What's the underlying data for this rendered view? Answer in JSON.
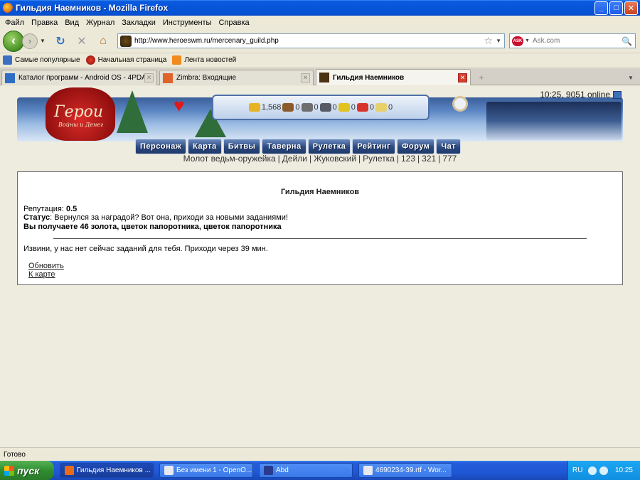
{
  "window": {
    "title": "Гильдия Наемников - Mozilla Firefox",
    "minimize": "_",
    "maximize": "□",
    "close": "✕"
  },
  "menu": [
    "Файл",
    "Правка",
    "Вид",
    "Журнал",
    "Закладки",
    "Инструменты",
    "Справка"
  ],
  "nav": {
    "url": "http://www.heroeswm.ru/mercenary_guild.php",
    "search_placeholder": "Ask.com",
    "search_engine_label": "ASK"
  },
  "bookmarks": [
    {
      "label": "Самые популярные",
      "icon": "popular-icon"
    },
    {
      "label": "Начальная страница",
      "icon": "start-page-icon"
    },
    {
      "label": "Лента новостей",
      "icon": "rss-icon"
    }
  ],
  "tabs": [
    {
      "label": "Каталог программ - Android OS - 4PDA",
      "active": false
    },
    {
      "label": "Zimbra: Входящие",
      "active": false
    },
    {
      "label": "Гильдия Наемников",
      "active": true
    }
  ],
  "game": {
    "logo_title": "Герои",
    "logo_subtitle": "Войны и Денег",
    "online": "10:25, 9051 online",
    "resources": [
      {
        "name": "gold",
        "value": "1,568"
      },
      {
        "name": "wood",
        "value": "0"
      },
      {
        "name": "ore",
        "value": "0"
      },
      {
        "name": "mercury",
        "value": "0"
      },
      {
        "name": "sulfur",
        "value": "0"
      },
      {
        "name": "crystal",
        "value": "0"
      },
      {
        "name": "gems",
        "value": "0"
      }
    ],
    "nav": [
      "Персонаж",
      "Карта",
      "Битвы",
      "Таверна",
      "Рулетка",
      "Рейтинг",
      "Форум",
      "Чат"
    ],
    "quicklinks": [
      "Молот ведьм-оружейка",
      "Дейли",
      "Жуковский",
      "Рулетка",
      "123",
      "321",
      "777"
    ]
  },
  "guild": {
    "title": "Гильдия Наемников",
    "reputation_label": "Репутация:",
    "reputation_value": "0.5",
    "status_label": "Статус",
    "status_text": ": Вернулся за наградой? Вот она, приходи за новыми заданиями!",
    "reward": "Вы получаете 46 золота, цветок папоротника, цветок папоротника",
    "message": "Извини, у нас нет сейчас заданий для тебя. Приходи через 39 мин.",
    "refresh": "Обновить",
    "to_map": "К карте"
  },
  "statusbar": "Готово",
  "taskbar": {
    "start": "пуск",
    "tasks": [
      {
        "label": "Гильдия Наемников ...",
        "active": true
      },
      {
        "label": "Без имени 1 - OpenO...",
        "active": false
      },
      {
        "label": "Abd",
        "active": false
      },
      {
        "label": "4690234-39.rtf - Wor...",
        "active": false
      }
    ],
    "lang": "RU",
    "clock": "10:25"
  },
  "colors": {
    "title_bar": "#0754d8",
    "nav_button": "#2c4a82",
    "content_bg": "#eeebdf",
    "taskbar": "#245edb"
  }
}
